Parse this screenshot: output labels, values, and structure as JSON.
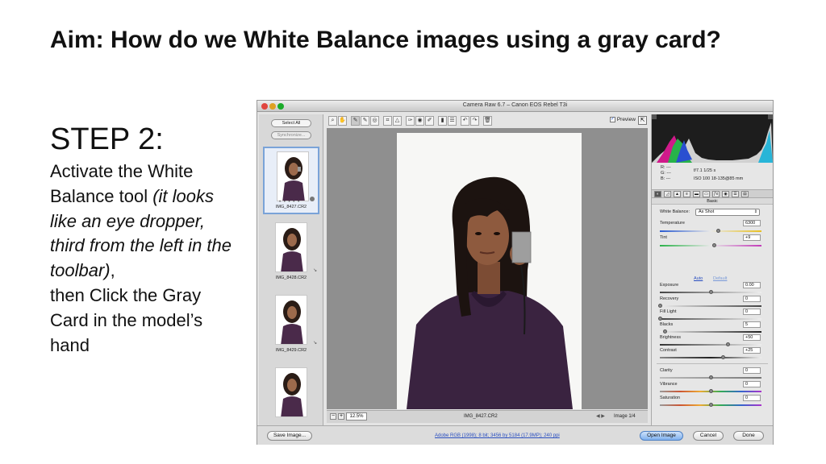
{
  "slide": {
    "title": "Aim: How do we White Balance images using a gray card?",
    "step_heading": "STEP 2:",
    "step_text_1": "Activate the White Balance tool",
    "step_text_italic": "(it looks like an eye dropper, third from the left in the toolbar)",
    "step_text_comma": ",",
    "step_text_2": "then Click the Gray Card in the model’s hand"
  },
  "window": {
    "title": "Camera Raw 6.7  –  Canon EOS Rebel T3i"
  },
  "filmstrip": {
    "select_all": "Select All",
    "synchronize": "Synchronize...",
    "thumbnails": [
      {
        "label": "IMG_8427.CR2",
        "selected": true
      },
      {
        "label": "IMG_8428.CR2",
        "selected": false
      },
      {
        "label": "IMG_8429.CR2",
        "selected": false
      },
      {
        "label": "",
        "selected": false
      }
    ]
  },
  "toolbar": {
    "tools": [
      "zoom-icon",
      "hand-icon",
      "white-balance-dropper-icon",
      "color-sampler-icon",
      "target-adjust-icon",
      "crop-icon",
      "straighten-icon",
      "spot-removal-icon",
      "red-eye-icon",
      "adjustment-brush-icon",
      "graduated-filter-icon",
      "preferences-icon",
      "rotate-left-icon",
      "rotate-right-icon",
      "trash-icon"
    ],
    "active_tool": "white-balance-dropper-icon",
    "preview_label": "Preview",
    "preview_checked": true
  },
  "status": {
    "zoom": "12.5%",
    "filename": "IMG_8427.CR2",
    "image_count": "Image 1/4"
  },
  "readout": {
    "r": "R:  ---",
    "g": "G:  ---",
    "b": "B:  ---",
    "aperture_shutter": "f/7.1   1/25 s",
    "iso_lens": "ISO 100   18-135@85 mm"
  },
  "panel": {
    "name": "Basic",
    "white_balance_label": "White Balance:",
    "white_balance_value": "As Shot",
    "temperature_label": "Temperature",
    "temperature_value": "6300",
    "tint_label": "Tint",
    "tint_value": "+9",
    "auto_label": "Auto",
    "default_label": "Default",
    "exposure_label": "Exposure",
    "exposure_value": "0.00",
    "recovery_label": "Recovery",
    "recovery_value": "0",
    "fill_light_label": "Fill Light",
    "fill_light_value": "0",
    "blacks_label": "Blacks",
    "blacks_value": "5",
    "brightness_label": "Brightness",
    "brightness_value": "+50",
    "contrast_label": "Contrast",
    "contrast_value": "+25",
    "clarity_label": "Clarity",
    "clarity_value": "0",
    "vibrance_label": "Vibrance",
    "vibrance_value": "0",
    "saturation_label": "Saturation",
    "saturation_value": "0"
  },
  "footer": {
    "save_image": "Save Image...",
    "workflow_options": "Adobe RGB (1998); 8 bit; 3456 by 5184 (17.9MP); 240 ppi",
    "open_image": "Open Image",
    "cancel": "Cancel",
    "done": "Done"
  },
  "colors": {
    "primary_button": "#7fb0ee",
    "link": "#2a4fc0",
    "canvas_bg": "#8f8f8f",
    "histogram_bg": "#1d1d1d"
  }
}
